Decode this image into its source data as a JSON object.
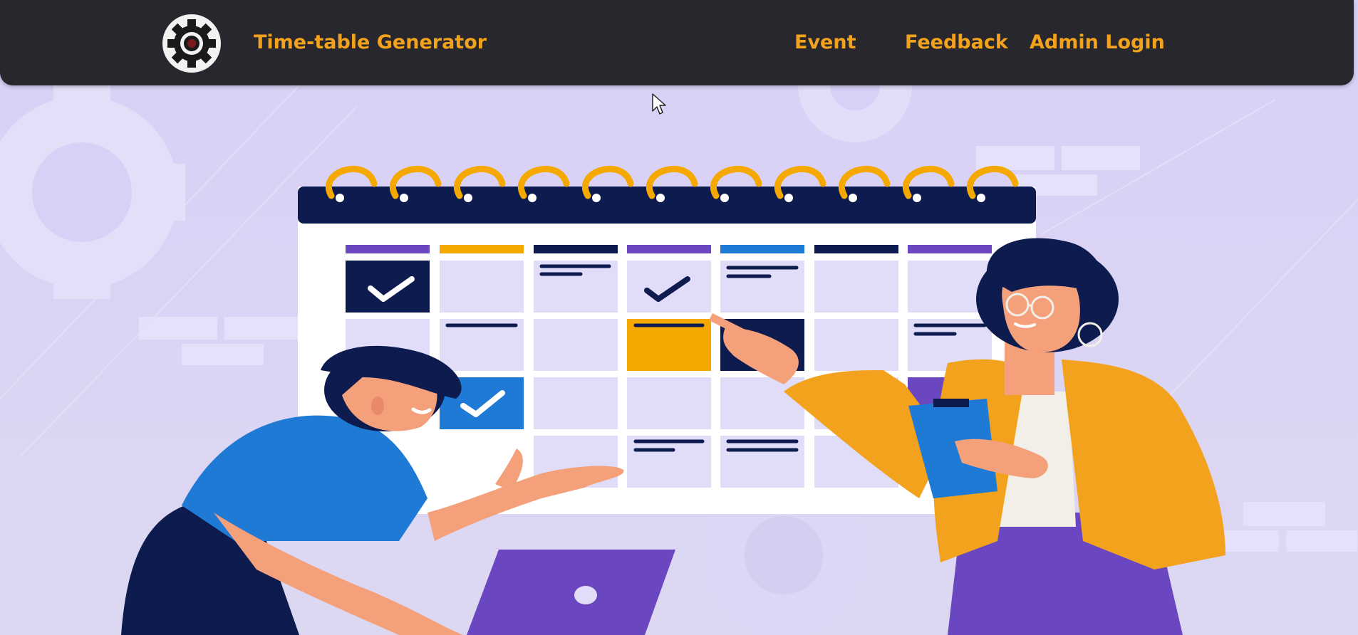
{
  "navbar": {
    "brand": "Time-table Generator",
    "links": [
      {
        "label": "Event"
      },
      {
        "label": "Feedback"
      },
      {
        "label": "Admin Login"
      }
    ]
  },
  "icons": {
    "logo": "gear-logo-icon",
    "cursor": "mouse-pointer-icon"
  },
  "colors": {
    "navbar_bg": "#27272d",
    "accent": "#f2a21c",
    "hero_bg": "#d9d2f5",
    "calendar_header": "#0d1b4f",
    "purple": "#6b46c1",
    "blue": "#1f7ad6",
    "yellow": "#f5a900"
  }
}
